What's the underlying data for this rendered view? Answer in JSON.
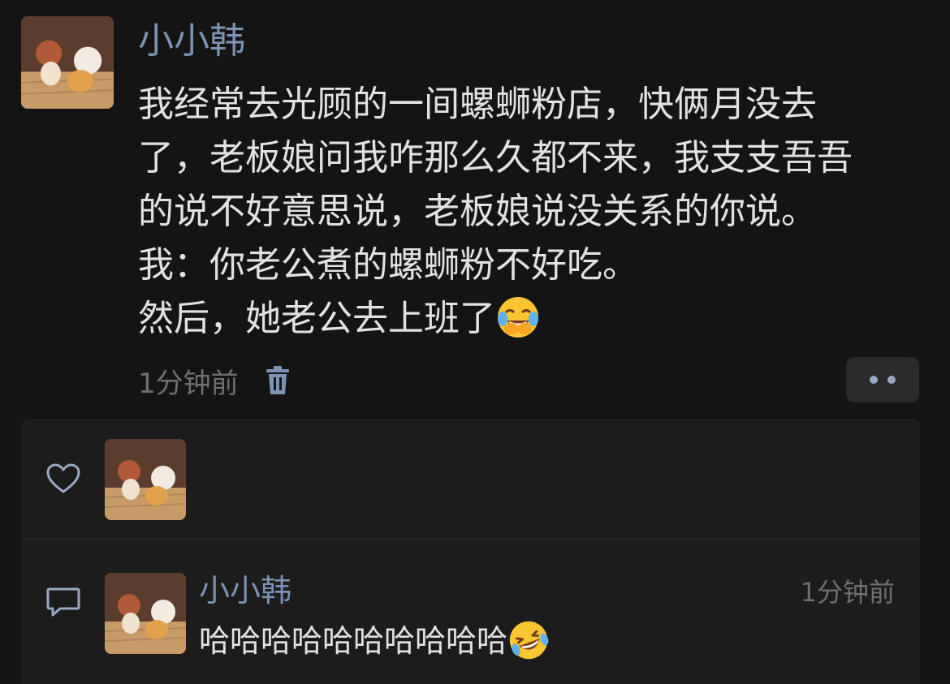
{
  "post": {
    "author": "小小韩",
    "lines": [
      "我经常去光顾的一间螺蛳粉店，快俩月没去",
      "了，老板娘问我咋那么久都不来，我支支吾吾",
      "的说不好意思说，老板娘说没关系的你说。",
      "我：你老公煮的螺蛳粉不好吃。",
      "然后，她老公去上班了"
    ],
    "time": "1分钟前",
    "emoji_icon": "face-with-tears-of-joy-icon"
  },
  "comment": {
    "author": "小小韩",
    "time": "1分钟前",
    "text": "哈哈哈哈哈哈哈哈哈哈",
    "emoji_icon": "rolling-on-floor-laughing-icon"
  },
  "colors": {
    "background": "#141414",
    "panel": "#1c1c1c",
    "name": "#7c93b3",
    "text": "#e2e2e2",
    "muted": "#6f6f6f"
  }
}
